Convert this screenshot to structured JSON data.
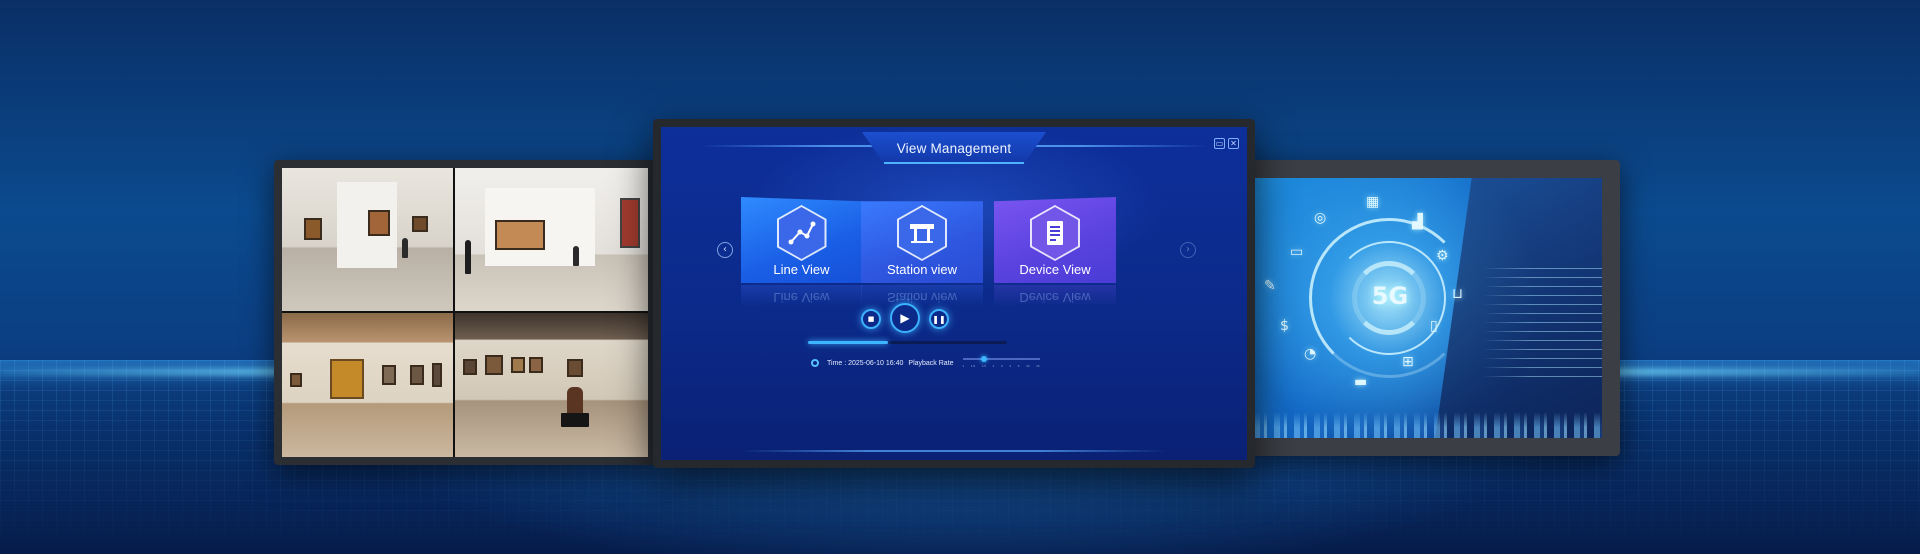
{
  "app": {
    "title": "View Management",
    "window_buttons": [
      "▭",
      "✕"
    ]
  },
  "views": [
    {
      "label": "Line View",
      "icon": "line-route-icon"
    },
    {
      "label": "Station view",
      "icon": "station-icon"
    },
    {
      "label": "Device View",
      "icon": "device-document-icon"
    }
  ],
  "nav": {
    "prev_icon": "chevron-left-icon",
    "next_icon": "chevron-right-icon"
  },
  "playback": {
    "stop_icon": "■",
    "play_icon": "▶",
    "pause_icon": "❚❚",
    "progress": 0.4,
    "time_label": "Time : 2025-06-10 16:40",
    "rate_label": "Playback Rate",
    "rate_position": 0.28,
    "rate_ticks": [
      "1",
      "1.5",
      "1.5",
      "2",
      "3",
      "4",
      "5",
      "10",
      "16"
    ]
  },
  "side_screens": {
    "left": "gallery-photos",
    "right_text": "5G"
  },
  "colors": {
    "accent": "#3db5ff",
    "app_background": "#0c2a8a",
    "page_background": "#0b4a8e"
  }
}
